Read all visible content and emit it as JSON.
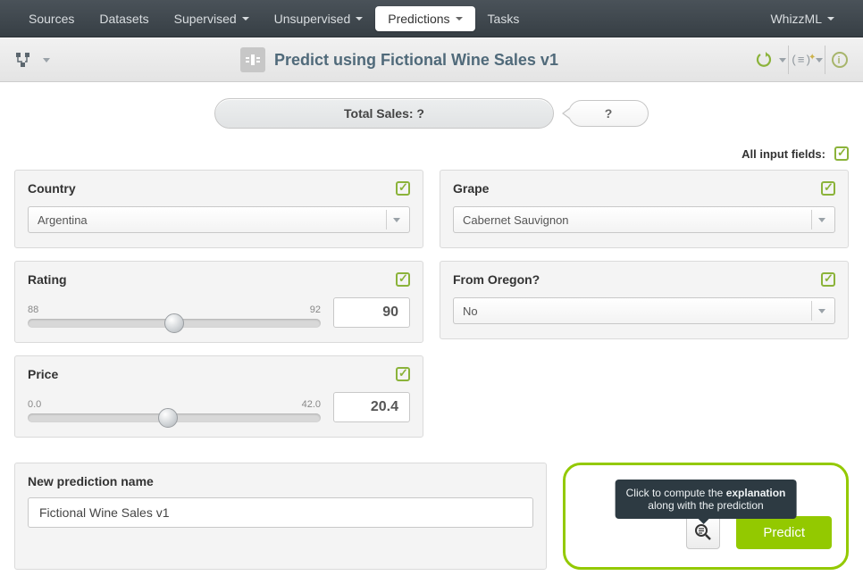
{
  "nav": {
    "items": [
      "Sources",
      "Datasets",
      "Supervised",
      "Unsupervised",
      "Predictions",
      "Tasks"
    ],
    "dropdown_flags": [
      false,
      false,
      true,
      true,
      true,
      false
    ],
    "active_index": 4,
    "right": "WhizzML"
  },
  "titlebar": {
    "title": "Predict using Fictional Wine Sales v1"
  },
  "result": {
    "label": "Total Sales: ?",
    "confidence": "?"
  },
  "all_fields_label": "All input fields:",
  "fields": {
    "country": {
      "label": "Country",
      "value": "Argentina"
    },
    "grape": {
      "label": "Grape",
      "value": "Cabernet Sauvignon"
    },
    "rating": {
      "label": "Rating",
      "min": "88",
      "max": "92",
      "value": "90",
      "pct": 50
    },
    "oregon": {
      "label": "From Oregon?",
      "value": "No"
    },
    "price": {
      "label": "Price",
      "min": "0.0",
      "max": "42.0",
      "value": "20.4",
      "pct": 48
    }
  },
  "bottom": {
    "name_label": "New prediction name",
    "name_value": "Fictional Wine Sales v1",
    "tooltip_line1_a": "Click to compute the ",
    "tooltip_line1_b": "explanation",
    "tooltip_line2": "along with the prediction",
    "predict_label": "Predict"
  }
}
